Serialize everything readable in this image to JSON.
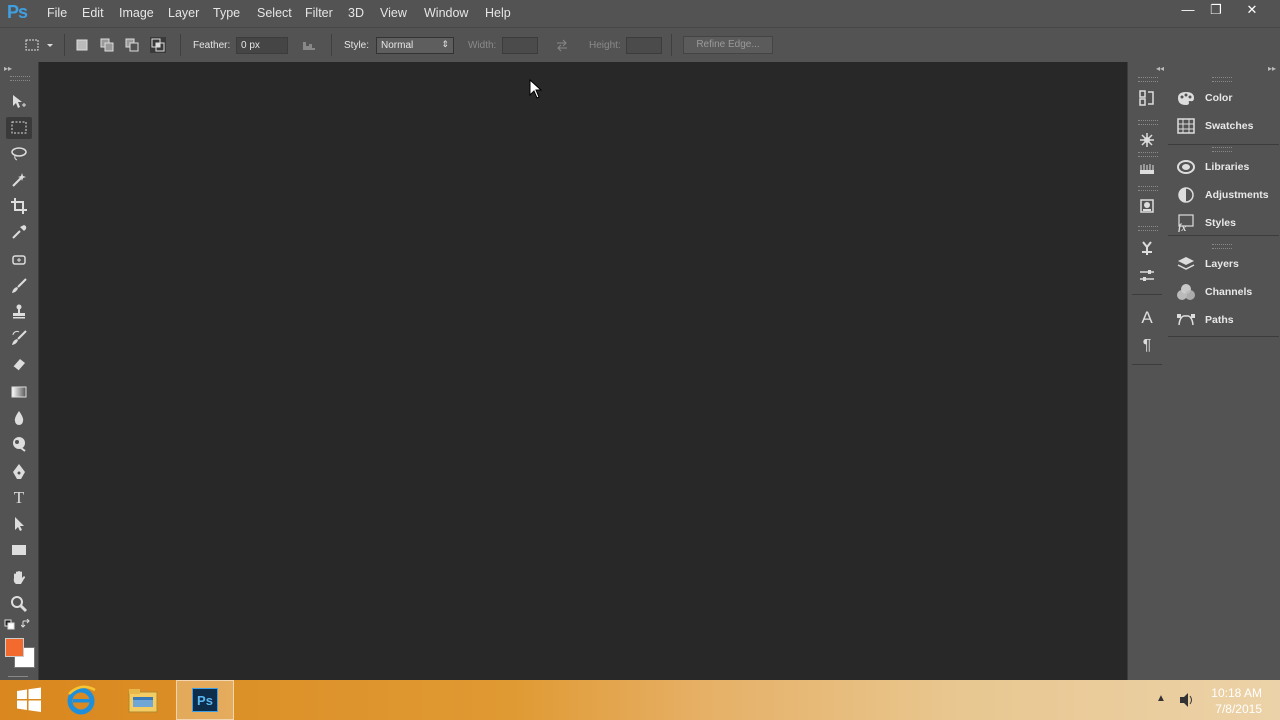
{
  "app": {
    "logo": "Ps"
  },
  "menu": [
    "File",
    "Edit",
    "Image",
    "Layer",
    "Type",
    "Select",
    "Filter",
    "3D",
    "View",
    "Window",
    "Help"
  ],
  "window_controls": {
    "minimize": "—",
    "restore": "❐",
    "close": "✕"
  },
  "options": {
    "feather_label": "Feather:",
    "feather_value": "0 px",
    "style_label": "Style:",
    "style_value": "Normal",
    "width_label": "Width:",
    "height_label": "Height:",
    "refine_edge": "Refine Edge..."
  },
  "panels": {
    "group1": [
      "Color",
      "Swatches"
    ],
    "group2": [
      "Libraries",
      "Adjustments",
      "Styles"
    ],
    "group3": [
      "Layers",
      "Channels",
      "Paths"
    ]
  },
  "toolbar": {
    "foreground_color": "#f26a2e",
    "background_color": "#ffffff"
  },
  "taskbar": {
    "time": "10:18 AM",
    "date": "7/8/2015",
    "ps_label": "Ps"
  }
}
